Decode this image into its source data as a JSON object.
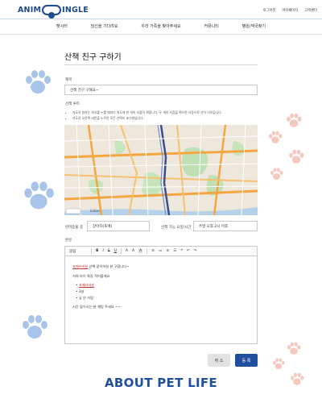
{
  "header": {
    "logo_left": "ANIM",
    "logo_right": "INGLE",
    "links": [
      "로그아웃",
      "마이페이지",
      "고객센터"
    ]
  },
  "nav": {
    "items": [
      "펫시터",
      "당신을 기다려요",
      "우리 가족을 찾아주세요",
      "커뮤니티",
      "병원/약국찾기"
    ]
  },
  "page": {
    "title": "산책 친구 구하기"
  },
  "form": {
    "subject_label": "제목",
    "subject_value": "산책 친구 구해요~",
    "route_label": "산책 루트",
    "notes": [
      "지도의 원하는 위치를 누를 때마다 지도에 한 개의 지점이 찍힙니다. 두 개의 지점을 찍으면 자동으로 선이 이어집니다.",
      "지도의 오른쪽 버튼을 누르면 모든 선택이 초기화됩니다."
    ],
    "map_caption": "kakao",
    "pet_type_label": "반려동물 종",
    "pet_type_value": "강아지(포메)",
    "time_label": "산책 가능 요일/시간",
    "time_value": "주말 오후 2시 이후",
    "content_label": "본문"
  },
  "toolbar": {
    "font_select": "굴림",
    "items": [
      "B",
      "I",
      "S",
      "U",
      "A",
      "A",
      "A",
      "≡",
      "≔",
      "≡",
      "☰",
      "❝",
      "↶",
      "↷"
    ]
  },
  "editor": {
    "lines": [
      {
        "prefix": "",
        "red": "포메러버분",
        "text": " 산책 같이하실 분 구합니다~"
      },
      {
        "prefix": "",
        "red": "",
        "text": "저희 아이 특징 적어볼게요"
      },
      {
        "prefix": "• ",
        "red": "포메러버분",
        "text": ""
      },
      {
        "prefix": "• ",
        "red": "",
        "text": "3살"
      },
      {
        "prefix": "• ",
        "red": "",
        "text": "낯 안 가림"
      },
      {
        "prefix": "",
        "red": "",
        "text": "시간 맞으시는 분 채팅 주세요 ~~"
      }
    ]
  },
  "buttons": {
    "cancel": "취 소",
    "submit": "등 록"
  },
  "footer": {
    "banner": "ABOUT PET LIFE"
  },
  "colors": {
    "brand": "#1f4f9e",
    "paw": "#a9c4ea",
    "paw_pink": "#f4c8bf"
  }
}
